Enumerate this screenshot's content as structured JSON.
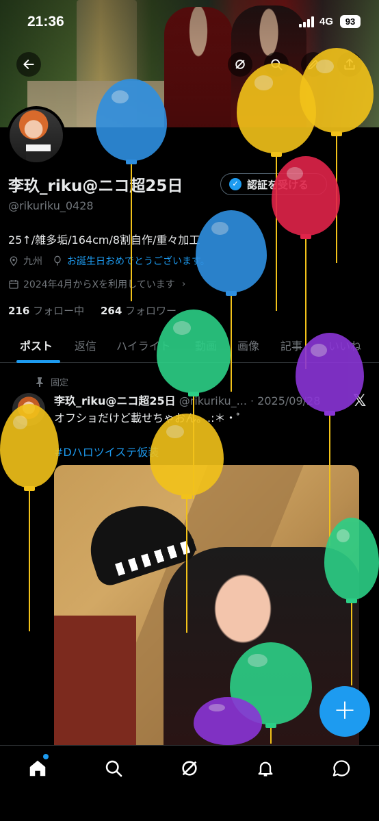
{
  "status_bar": {
    "time": "21:36",
    "network": "4G",
    "battery": "93"
  },
  "profile": {
    "display_name": "李玖_riku@ニコ超25日",
    "verify_button": "認証を受ける",
    "handle": "@rikuriku_0428",
    "bio": "25↑/雑多垢/164cm/8割自作/重々加工",
    "location": "九州",
    "birthday_text": "お誕生日おめでとうございます。",
    "joined": "2024年4月からXを利用しています",
    "following_count": "216",
    "following_label": "フォロー中",
    "followers_count": "264",
    "followers_label": "フォロワー"
  },
  "tabs": [
    "ポスト",
    "返信",
    "ハイライト",
    "動画",
    "画像",
    "記事",
    "いいね"
  ],
  "active_tab": "ポスト",
  "post": {
    "pinned_label": "固定",
    "author_name": "李玖_riku@ニコ超25日",
    "author_meta": "@rikuriku_... · 2025/09/28",
    "text": "オフショだけど載せちゃおん。.:＊・゜",
    "hashtag": "#Dハロツイステ仮装"
  },
  "fab_label": "+",
  "icons": {
    "back": "back-arrow-icon",
    "grok": "grok-icon",
    "search": "search-icon",
    "edit": "edit-icon",
    "share": "share-icon",
    "home": "home-icon",
    "notifications": "bell-icon",
    "messages": "chat-icon"
  },
  "colors": {
    "accent": "#1d9bf0",
    "balloon_blue": "#2f8fe0",
    "balloon_yellow": "#f2c21a",
    "balloon_red": "#e0244a",
    "balloon_green": "#2ccf86",
    "balloon_purple": "#8a35d6"
  }
}
